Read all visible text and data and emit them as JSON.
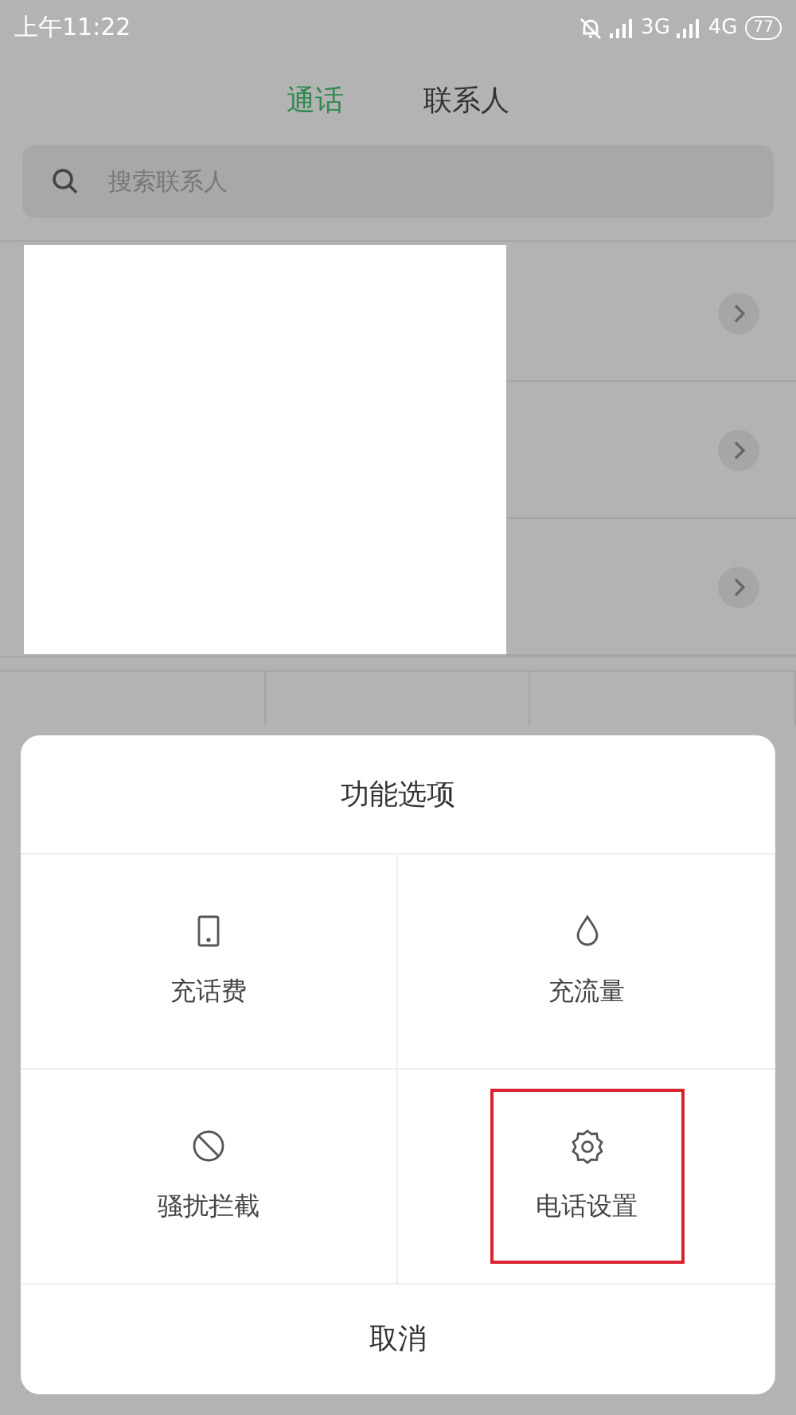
{
  "status_bar": {
    "time": "上午11:22",
    "network_1": "3G",
    "network_2": "4G",
    "battery": "77"
  },
  "tabs": [
    {
      "label": "通话",
      "selected": true
    },
    {
      "label": "联系人",
      "selected": false
    }
  ],
  "search": {
    "placeholder": "搜索联系人"
  },
  "sheet": {
    "title": "功能选项",
    "options": [
      {
        "kind": "phone",
        "label": "充话费",
        "highlighted": false
      },
      {
        "kind": "drop",
        "label": "充流量",
        "highlighted": false
      },
      {
        "kind": "block",
        "label": "骚扰拦截",
        "highlighted": false
      },
      {
        "kind": "gear",
        "label": "电话设置",
        "highlighted": true
      }
    ],
    "cancel": "取消"
  }
}
